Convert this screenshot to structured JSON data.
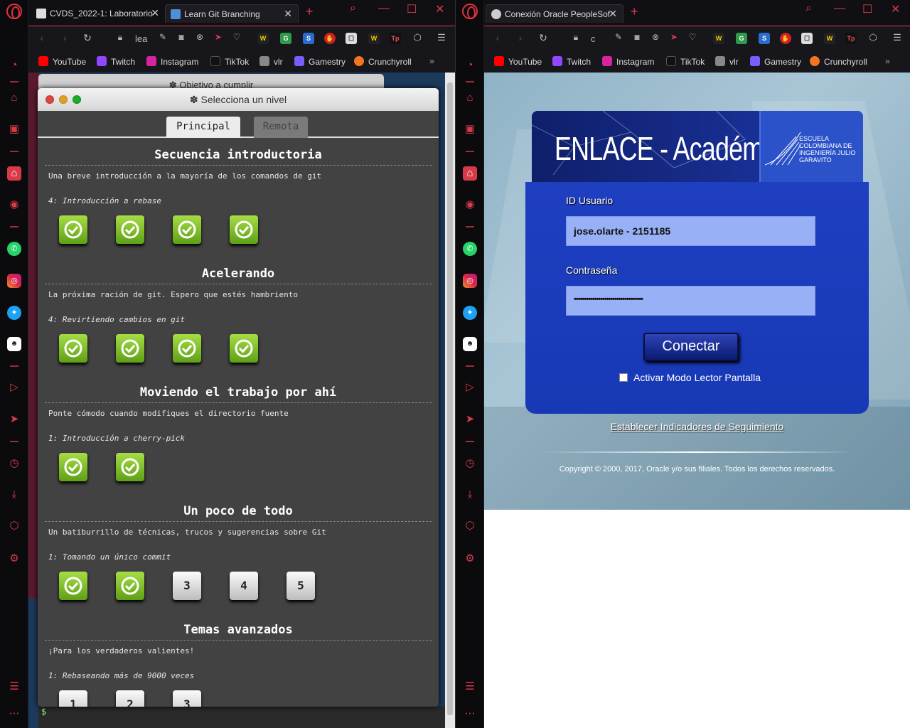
{
  "left_window": {
    "tabs": [
      {
        "label": "CVDS_2022-1: Laboratorio"
      },
      {
        "label": "Learn Git Branching"
      }
    ],
    "address": "lea",
    "bookmarks": [
      "YouTube",
      "Twitch",
      "Instagram",
      "TikTok",
      "vlr",
      "Gamestry",
      "Crunchyroll"
    ],
    "behind_window_title": "✽ Objetivo a cumplir",
    "dialog_title": "✽ Selecciona un nivel",
    "dialog_tabs": [
      "Principal",
      "Remota"
    ],
    "terminal_prompt": "$",
    "sections": [
      {
        "title": "Secuencia introductoria",
        "description": "Una breve introducción a la mayoría de los comandos de git",
        "current": "4: Introducción a rebase",
        "levels": [
          {
            "label": "",
            "done": true
          },
          {
            "label": "",
            "done": true
          },
          {
            "label": "",
            "done": true
          },
          {
            "label": "",
            "done": true
          }
        ]
      },
      {
        "title": "Acelerando",
        "description": "La próxima ración de git. Espero que estés hambriento",
        "current": "4: Revirtiendo cambios en git",
        "levels": [
          {
            "label": "",
            "done": true
          },
          {
            "label": "",
            "done": true
          },
          {
            "label": "",
            "done": true
          },
          {
            "label": "",
            "done": true
          }
        ]
      },
      {
        "title": "Moviendo el trabajo por ahí",
        "description": "Ponte cómodo cuando modifiques el directorio fuente",
        "current": "1: Introducción a cherry-pick",
        "levels": [
          {
            "label": "",
            "done": true
          },
          {
            "label": "",
            "done": true
          }
        ]
      },
      {
        "title": "Un poco de todo",
        "description": "Un batiburrillo de técnicas, trucos y sugerencias sobre Git",
        "current": "1: Tomando un único commit",
        "levels": [
          {
            "label": "",
            "done": true
          },
          {
            "label": "",
            "done": true
          },
          {
            "label": "3",
            "done": false
          },
          {
            "label": "4",
            "done": false
          },
          {
            "label": "5",
            "done": false
          }
        ]
      },
      {
        "title": "Temas avanzados",
        "description": "¡Para los verdaderos valientes!",
        "current": "1: Rebaseando más de 9000 veces",
        "levels": [
          {
            "label": "1",
            "done": false
          },
          {
            "label": "2",
            "done": false
          },
          {
            "label": "3",
            "done": false
          }
        ]
      }
    ]
  },
  "right_window": {
    "tabs": [
      {
        "label": "Conexión Oracle PeopleSof"
      }
    ],
    "address": "c",
    "bookmarks": [
      "YouTube",
      "Twitch",
      "Instagram",
      "TikTok",
      "vlr",
      "Gamestry",
      "Crunchyroll"
    ],
    "banner_title": "ENLACE - Académico",
    "banner_school": "ESCUELA COLOMBIANA DE INGENIERÍA JULIO GARAVITO",
    "user_label": "ID Usuario",
    "user_value": "jose.olarte - 2151185",
    "password_label": "Contraseña",
    "password_value": "••••••••••••••••••••••••••••••••••",
    "connect_button": "Conectar",
    "screen_reader_label": "Activar Modo Lector Pantalla",
    "tracking_link": "Establecer Indicadores de Seguimiento",
    "copyright": "Copyright © 2000, 2017, Oracle y/o sus filiales. Todos los derechos reservados."
  },
  "colors": {
    "opera_red": "#d83a4a",
    "dialog_bg": "#424242",
    "check_green": "#6fb21f",
    "login_blue": "#1e3fc0"
  }
}
